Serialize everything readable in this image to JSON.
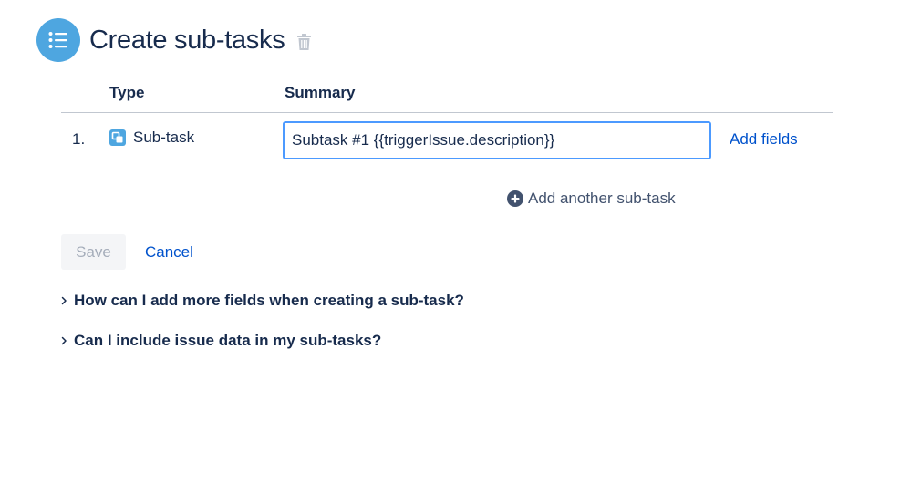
{
  "header": {
    "title": "Create sub-tasks",
    "icon": "list-icon",
    "delete_icon": "trash-icon"
  },
  "table": {
    "columns": [
      "Type",
      "Summary"
    ],
    "rows": [
      {
        "number": "1.",
        "type": "Sub-task",
        "type_icon": "subtask-icon",
        "summary": "Subtask #1 {{triggerIssue.description}}",
        "add_fields_label": "Add fields"
      }
    ]
  },
  "add_another_label": "Add another sub-task",
  "actions": {
    "save_label": "Save",
    "cancel_label": "Cancel"
  },
  "faq": [
    "How can I add more fields when creating a sub-task?",
    "Can I include issue data in my sub-tasks?"
  ],
  "colors": {
    "accent": "#4ea6e0",
    "link": "#0052cc",
    "focus": "#4c9aff",
    "text": "#172b4d"
  }
}
